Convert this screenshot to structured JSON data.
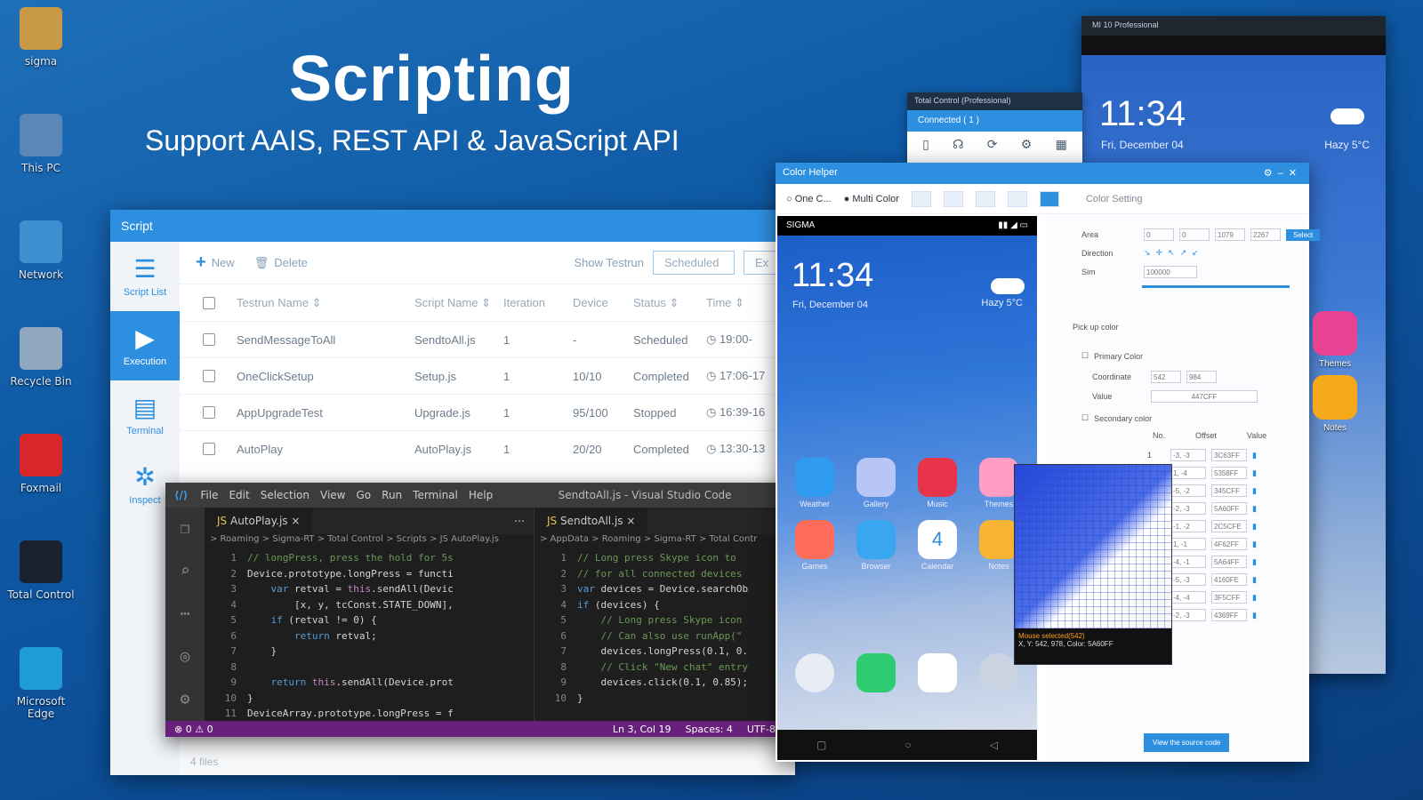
{
  "desktop": {
    "icons": [
      {
        "name": "sigma-icon",
        "label": "sigma"
      },
      {
        "name": "this-pc-icon",
        "label": "This PC"
      },
      {
        "name": "network-icon",
        "label": "Network"
      },
      {
        "name": "recycle-bin-icon",
        "label": "Recycle Bin"
      },
      {
        "name": "foxmail-icon",
        "label": "Foxmail"
      },
      {
        "name": "total-control-icon",
        "label": "Total Control"
      },
      {
        "name": "edge-icon",
        "label": "Microsoft Edge"
      }
    ]
  },
  "headline": {
    "title": "Scripting",
    "subtitle": "Support AAIS, REST API & JavaScript API"
  },
  "script_window": {
    "title": "Script",
    "sidebar": [
      {
        "label": "Script List",
        "glyph": "☰"
      },
      {
        "label": "Execution",
        "glyph": "▶"
      },
      {
        "label": "Terminal",
        "glyph": "▤"
      },
      {
        "label": "Inspect",
        "glyph": "✲"
      }
    ],
    "toolbar": {
      "new": "New",
      "delete": "Delete",
      "show_testrun": "Show Testrun",
      "filter": "Scheduled",
      "extra": "Ex"
    },
    "columns": [
      "Testrun Name ⇕",
      "Script Name ⇕",
      "Iteration",
      "Device",
      "Status ⇕",
      "Time ⇕"
    ],
    "rows": [
      [
        "SendMessageToAll",
        "SendtoAll.js",
        "1",
        "-",
        "Scheduled",
        "◷ 19:00-"
      ],
      [
        "OneClickSetup",
        "Setup.js",
        "1",
        "10/10",
        "Completed",
        "◷ 17:06-17"
      ],
      [
        "AppUpgradeTest",
        "Upgrade.js",
        "1",
        "95/100",
        "Stopped",
        "◷ 16:39-16"
      ],
      [
        "AutoPlay",
        "AutoPlay.js",
        "1",
        "20/20",
        "Completed",
        "◷ 13:30-13"
      ]
    ],
    "footer": "4 files"
  },
  "vscode": {
    "menu": [
      "File",
      "Edit",
      "Selection",
      "View",
      "Go",
      "Run",
      "Terminal",
      "Help"
    ],
    "title": "SendtoAll.js - Visual Studio Code",
    "left_tab": "AutoPlay.js",
    "right_tab": "SendtoAll.js",
    "left_crumb": "> Roaming > Sigma-RT > Total Control > Scripts > JS AutoPlay.js",
    "right_crumb": "> AppData > Roaming > Sigma-RT > Total Contr",
    "left_code": [
      "// longPress, press the hold for 5s",
      "Device.prototype.longPress = functi",
      "    var retval = this.sendAll(Devic",
      "        [x, y, tcConst.STATE_DOWN],",
      "    if (retval != 0) {",
      "        return retval;",
      "    }",
      "",
      "    return this.sendAll(Device.prot",
      "}",
      "DeviceArray.prototype.longPress = f"
    ],
    "right_code": [
      "// Long press Skype icon to",
      "// for all connected devices",
      "var devices = Device.searchOb",
      "if (devices) {",
      "    // Long press Skype icon",
      "    // Can also use runApp(\"",
      "    devices.longPress(0.1, 0.",
      "    // Click \"New chat\" entry",
      "    devices.click(0.1, 0.85);",
      "}"
    ],
    "status_left": "⊗ 0 ⚠ 0",
    "status_right": [
      "Ln 3, Col 19",
      "Spaces: 4",
      "UTF-8"
    ]
  },
  "tc_small": {
    "title": "Total Control (Professional)",
    "connected": "Connected ( 1 )"
  },
  "phone_back": {
    "title": "MI 10 Professional",
    "time": "11:34",
    "date": "Fri, December 04",
    "weather": "Hazy 5°C"
  },
  "color_helper": {
    "title": "Color Helper",
    "toolbar": {
      "one_color": "One C...",
      "multi_color": "Multi Color",
      "color_setting": "Color Setting"
    },
    "phone": {
      "carrier": "SIGMA",
      "time": "11:34",
      "date": "Fri, December 04",
      "weather": "Hazy 5°C",
      "apps_row1": [
        "Weather",
        "Gallery",
        "Music",
        "Themes"
      ],
      "apps_row2": [
        "Games",
        "Browser",
        "Calendar",
        "Notes"
      ],
      "calendar_day": "4"
    },
    "settings": {
      "area_label": "Area",
      "area_values": [
        "0",
        "0",
        "1079",
        "2267"
      ],
      "area_select": "Select",
      "direction_label": "Direction",
      "sim_label": "Sim",
      "sim_value": "100000",
      "pick_up": "Pick up color",
      "primary": "Primary Color",
      "coordinate_label": "Coordinate",
      "coord_x": "542",
      "coord_y": "984",
      "value_label": "Value",
      "value": "447CFF",
      "secondary": "Secondary color",
      "sec_headers": [
        "No.",
        "Offset",
        "Value"
      ],
      "sec_rows": [
        [
          "1",
          "-3, -3",
          "3C63FF"
        ],
        [
          "",
          "1, -4",
          "5358FF"
        ],
        [
          "",
          "-5, -2",
          "345CFF"
        ],
        [
          "",
          "-2, -3",
          "5A60FF"
        ],
        [
          "",
          "-1, -2",
          "2C5CFE"
        ],
        [
          "",
          "1, -1",
          "4F62FF"
        ],
        [
          "",
          "-4, -1",
          "5A64FF"
        ],
        [
          "",
          "-5, -3",
          "4160FE"
        ],
        [
          "",
          "-4, -4",
          "3F5CFF"
        ],
        [
          "",
          "-2, -3",
          "4369FF"
        ]
      ],
      "view_source": "View the source code"
    },
    "magnifier": {
      "line1": "Mouse selected(542)",
      "line2": "X, Y: 542, 978, Color: 5A60FF"
    }
  },
  "side_apps": [
    {
      "name": "themes-app",
      "label": "Themes",
      "color": "#e84393"
    },
    {
      "name": "notes-app",
      "label": "Notes",
      "color": "#f6a91a"
    }
  ]
}
